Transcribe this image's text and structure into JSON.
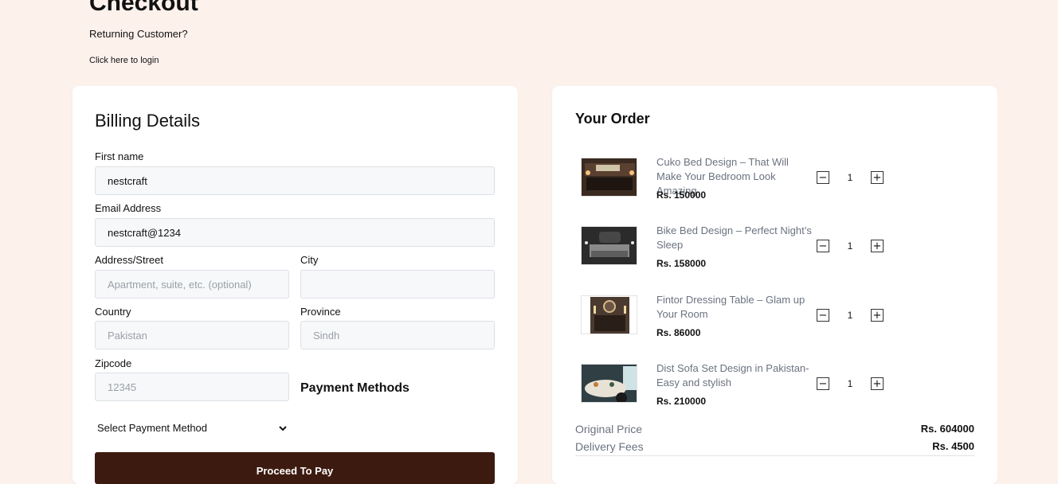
{
  "page": {
    "title": "Checkout",
    "returning_text": "Returning Customer?",
    "login_link": "Click here to login"
  },
  "billing": {
    "title": "Billing Details",
    "first_name": {
      "label": "First name",
      "value": "nestcraft",
      "placeholder": ""
    },
    "email": {
      "label": "Email Address",
      "value": "nestcraft@1234",
      "placeholder": ""
    },
    "address": {
      "label": "Address/Street",
      "value": "",
      "placeholder": "Apartment, suite, etc. (optional)"
    },
    "city": {
      "label": "City",
      "value": "",
      "placeholder": ""
    },
    "country": {
      "label": "Country",
      "value": "",
      "placeholder": "Pakistan"
    },
    "province": {
      "label": "Province",
      "value": "",
      "placeholder": "Sindh"
    },
    "zipcode": {
      "label": "Zipcode",
      "value": "",
      "placeholder": "12345"
    },
    "payment_title": "Payment Methods",
    "payment_select": "Select Payment Method",
    "proceed_label": "Proceed To Pay"
  },
  "order": {
    "title": "Your Order",
    "items": [
      {
        "name": "Cuko Bed Design – That Will Make Your Bedroom Look Amazing",
        "price": "Rs. 150000",
        "qty": "1",
        "minus": "−",
        "plus": "+"
      },
      {
        "name": "Bike Bed Design – Perfect Night’s Sleep",
        "price": "Rs. 158000",
        "qty": "1",
        "minus": "−",
        "plus": "+"
      },
      {
        "name": "Fintor Dressing Table – Glam up Your Room",
        "price": "Rs. 86000",
        "qty": "1",
        "minus": "−",
        "plus": "+"
      },
      {
        "name": "Dist Sofa Set Design in Pakistan-Easy and stylish",
        "price": "Rs. 210000",
        "qty": "1",
        "minus": "−",
        "plus": "+"
      }
    ],
    "summary": {
      "original_label": "Original Price",
      "original_value": "Rs. 604000",
      "delivery_label": "Delivery Fees",
      "delivery_value": "Rs. 4500"
    }
  },
  "colors": {
    "background": "#fdf1ec",
    "button": "#3d1a10",
    "input_bg": "#f7f8fa"
  },
  "icons": {
    "select_chevron": "chevron-down-icon"
  }
}
